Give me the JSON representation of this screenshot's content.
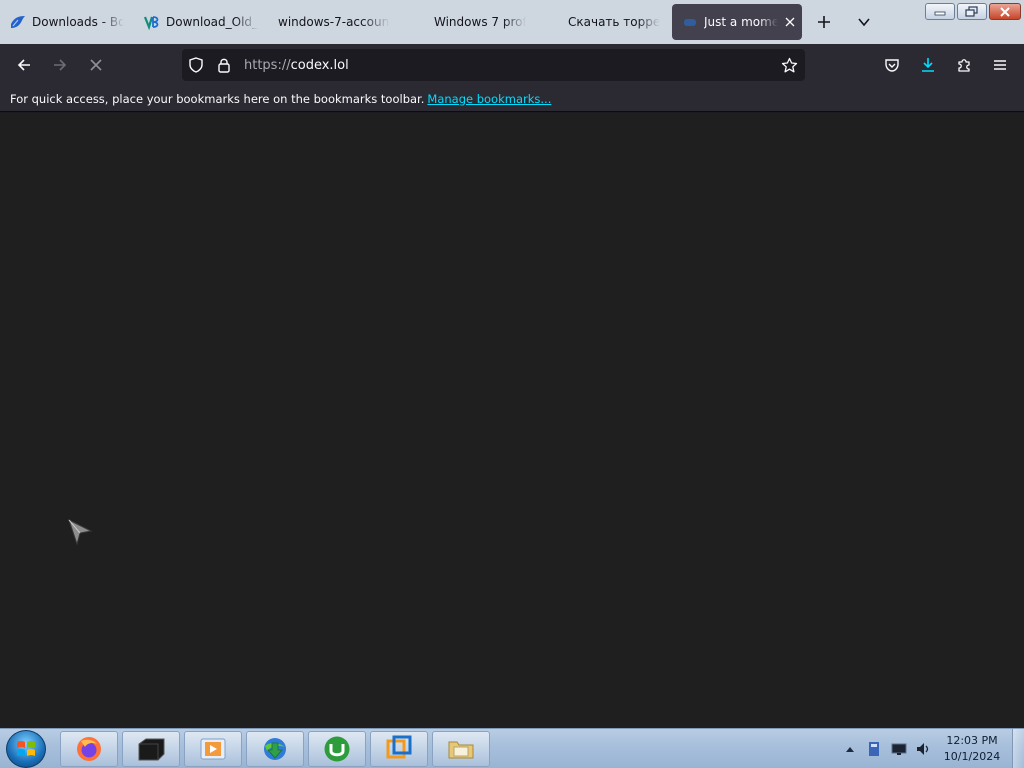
{
  "tabs": [
    {
      "title": "Downloads - Bo...",
      "favicon": "blue-bird-icon",
      "active": false
    },
    {
      "title": "Download_Old_B...",
      "favicon": "vb-logo-icon",
      "active": false
    },
    {
      "title": "windows-7-account...",
      "favicon": "none",
      "active": false
    },
    {
      "title": "Windows 7 profe...",
      "favicon": "microsoft-logo-icon",
      "active": false
    },
    {
      "title": "Скачать торрен...",
      "favicon": "microsoft-logo-icon",
      "active": false
    },
    {
      "title": "Just a moment...",
      "favicon": "loading-icon",
      "active": true
    }
  ],
  "nav": {
    "url_scheme": "https://",
    "url_host": "codex.lol"
  },
  "bookmarks": {
    "message": "For quick access, place your bookmarks here on the bookmarks toolbar.",
    "manage_link": "Manage bookmarks..."
  },
  "taskbar": {
    "apps": [
      "firefox-icon",
      "terminal-icon",
      "media-player-icon",
      "download-manager-icon",
      "utorrent-icon",
      "virtualbox-icon",
      "file-explorer-icon"
    ],
    "time": "12:03 PM",
    "date": "10/1/2024"
  },
  "colors": {
    "accent": "#00ddff",
    "download_icon": "#00ddff"
  }
}
